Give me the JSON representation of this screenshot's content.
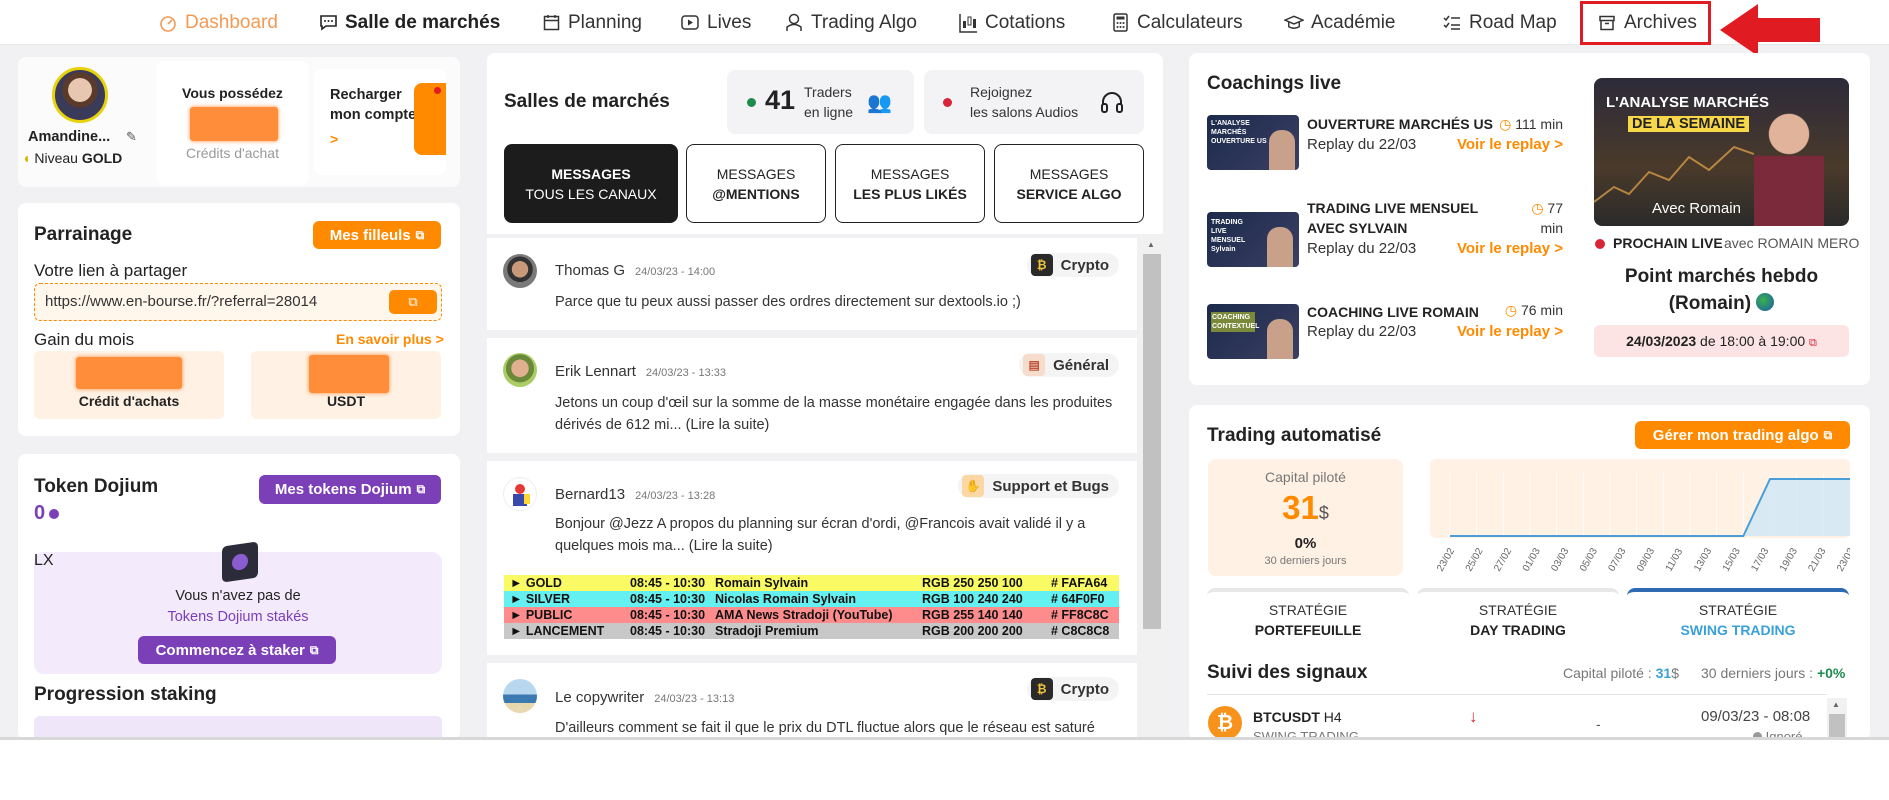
{
  "nav": {
    "items": [
      {
        "label": "Dashboard",
        "icon": "dashboard-icon"
      },
      {
        "label": "Salle de marchés",
        "icon": "chat-icon"
      },
      {
        "label": "Planning",
        "icon": "calendar-icon"
      },
      {
        "label": "Lives",
        "icon": "play-icon"
      },
      {
        "label": "Trading Algo",
        "icon": "robot-icon"
      },
      {
        "label": "Cotations",
        "icon": "candles-icon"
      },
      {
        "label": "Calculateurs",
        "icon": "calculator-icon"
      },
      {
        "label": "Académie",
        "icon": "graduation-cap-icon"
      },
      {
        "label": "Road Map",
        "icon": "checklist-icon"
      },
      {
        "label": "Archives",
        "icon": "archive-icon"
      }
    ],
    "active_color": "#f39a54",
    "highlight_color": "#e11b22"
  },
  "profile": {
    "name": "Amandine...",
    "level_prefix": "Niveau",
    "level": "GOLD",
    "owned_title": "Vous possédez",
    "owned_sub": "Crédits d'achat",
    "recharge_label": "Recharger mon compte",
    "recharge_arrow": ">"
  },
  "referral": {
    "title": "Parrainage",
    "button": "Mes filleuls",
    "link_label": "Votre lien à partager",
    "link_value": "https://www.en-bourse.fr/?referral=28014",
    "gain_label": "Gain du mois",
    "learn_more": "En savoir plus >",
    "credit_label": "Crédit d'achats",
    "usdt_label": "USDT"
  },
  "token": {
    "title": "Token Dojium",
    "button": "Mes tokens Dojium",
    "count": "0",
    "empty_line1": "Vous n'avez pas de",
    "empty_line2": "Tokens Dojium stakés",
    "stake_button": "Commencez à staker",
    "progress_title": "Progression staking"
  },
  "rooms": {
    "title": "Salles de marchés",
    "online_count": "41",
    "online_label1": "Traders",
    "online_label2": "en ligne",
    "audio_label1": "Rejoignez",
    "audio_label2": "les salons Audios",
    "tabs": [
      {
        "top": "MESSAGES",
        "bottom": "TOUS LES CANAUX"
      },
      {
        "top": "MESSAGES",
        "bottom": "@MENTIONS"
      },
      {
        "top": "MESSAGES",
        "bottom": "LES PLUS LIKÉS"
      },
      {
        "top": "MESSAGES",
        "bottom": "SERVICE ALGO"
      }
    ]
  },
  "messages": [
    {
      "author": "Thomas G",
      "date": "24/03/23 - 14:00",
      "channel": "Crypto",
      "text": "Parce que tu peux aussi passer des ordres directement sur dextools.io ;)"
    },
    {
      "author": "Erik Lennart",
      "date": "24/03/23 - 13:33",
      "channel": "Général",
      "text": "Jetons un coup d'œil sur la somme de la masse monétaire engagée dans les produites dérivés de 612 mi... (Lire la suite)"
    },
    {
      "author": "Bernard13",
      "date": "24/03/23 - 13:28",
      "channel": "Support et Bugs",
      "text": "Bonjour @Jezz A propos du planning sur écran d'ordi, @Francois avait validé il y a quelques mois ma... (Lire la suite)"
    },
    {
      "author": "Le copywriter",
      "date": "24/03/23 - 13:13",
      "channel": "Crypto",
      "text": "D'ailleurs comment se fait il que le prix du DTL fluctue alors que le réseau est saturé"
    }
  ],
  "planning_table": [
    {
      "name": "► GOLD",
      "time": "08:45 - 10:30",
      "who": "Romain Sylvain",
      "rgb": "RGB 250 250 100",
      "hex": "# FAFA64",
      "bg": "#FAFA64"
    },
    {
      "name": "► SILVER",
      "time": "08:45 - 10:30",
      "who": "Nicolas Romain Sylvain",
      "rgb": "RGB 100 240 240",
      "hex": "# 64F0F0",
      "bg": "#64F0F0"
    },
    {
      "name": "► PUBLIC",
      "time": "08:45 - 10:30",
      "who": "AMA News Stradoji (YouTube)",
      "rgb": "RGB 255 140 140",
      "hex": "# FF8C8C",
      "bg": "#FF8C8C"
    },
    {
      "name": "► LANCEMENT",
      "time": "08:45 - 10:30",
      "who": "Stradoji Premium",
      "rgb": "RGB 200 200 200",
      "hex": "# C8C8C8",
      "bg": "#C8C8C8"
    }
  ],
  "coaching": {
    "title": "Coachings live",
    "items": [
      {
        "title": "OUVERTURE MARCHÉS US",
        "duration": "111 min",
        "replay": "Replay du 22/03",
        "link": "Voir le replay >"
      },
      {
        "title": "TRADING LIVE MENSUEL AVEC SYLVAIN",
        "duration": "77 min",
        "replay": "Replay du 22/03",
        "link": "Voir le replay >"
      },
      {
        "title": "COACHING LIVE ROMAIN",
        "duration": "76 min",
        "replay": "Replay du 22/03",
        "link": "Voir le replay >"
      }
    ],
    "thumbs": [
      "L'ANALYSE MARCHÉS OUVERTURE US",
      "TRADING LIVE MENSUEL Sylvain",
      "COACHING CONTEXTUEL"
    ],
    "feature_line1": "L'ANALYSE MARCHÉS",
    "feature_line2": "DE LA SEMAINE",
    "feature_with": "Avec Romain",
    "next_label": "PROCHAIN LIVE",
    "next_with": "avec ROMAIN MERO",
    "next_title": "Point marchés hebdo (Romain)",
    "next_date": "24/03/2023",
    "next_time": "de 18:00 à 19:00"
  },
  "algo": {
    "title": "Trading automatisé",
    "button": "Gérer mon trading algo",
    "capital_label": "Capital piloté",
    "capital_value": "31",
    "capital_unit": "$",
    "perf": "0%",
    "period": "30 derniers jours",
    "strategies": [
      {
        "top": "STRATÉGIE",
        "bottom": "PORTEFEUILLE"
      },
      {
        "top": "STRATÉGIE",
        "bottom": "DAY TRADING"
      },
      {
        "top": "STRATÉGIE",
        "bottom": "SWING TRADING"
      }
    ]
  },
  "chart_data": {
    "type": "line",
    "x": [
      "23/02",
      "25/02",
      "27/02",
      "01/03",
      "03/03",
      "05/03",
      "07/03",
      "09/03",
      "11/03",
      "13/03",
      "15/03",
      "17/03",
      "19/03",
      "21/03",
      "23/03"
    ],
    "series": [
      {
        "values": [
          0,
          0,
          0,
          0,
          0,
          0,
          0,
          0,
          0,
          0,
          0,
          0,
          31,
          31,
          31,
          31
        ]
      }
    ],
    "line_color": "#4a9fd8"
  },
  "signals": {
    "title": "Suivi des signaux",
    "capital_label": "Capital piloté :",
    "capital_value": "31",
    "capital_unit": "$",
    "period_label": "30 derniers jours :",
    "period_value": "+0%",
    "row": {
      "pair": "BTCUSDT",
      "tf": "H4",
      "strategy": "SWING TRADING",
      "dash": "-",
      "date": "09/03/23 - 08:08",
      "status": "Ignoré"
    }
  }
}
